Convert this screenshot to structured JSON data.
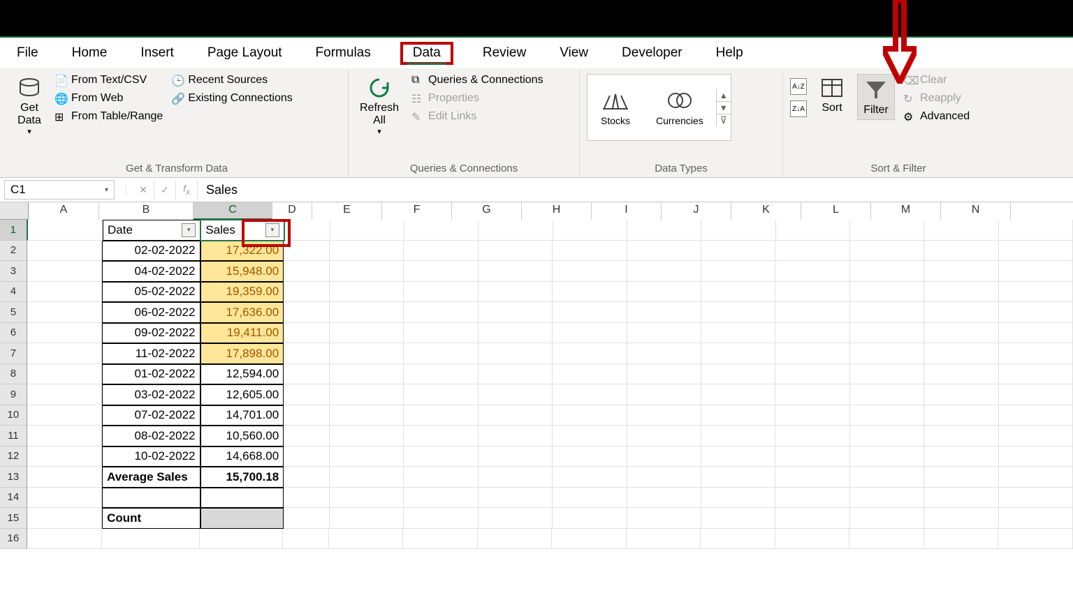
{
  "menu": [
    "File",
    "Home",
    "Insert",
    "Page Layout",
    "Formulas",
    "Data",
    "Review",
    "View",
    "Developer",
    "Help"
  ],
  "active_menu": "Data",
  "ribbon": {
    "get_transform": {
      "big": "Get\nData",
      "items": [
        "From Text/CSV",
        "From Web",
        "From Table/Range",
        "Recent Sources",
        "Existing Connections"
      ],
      "label": "Get & Transform Data"
    },
    "queries": {
      "big": "Refresh\nAll",
      "items": [
        "Queries & Connections",
        "Properties",
        "Edit Links"
      ],
      "label": "Queries & Connections"
    },
    "data_types": {
      "items": [
        "Stocks",
        "Currencies"
      ],
      "label": "Data Types"
    },
    "sort_filter": {
      "sort": "Sort",
      "filter": "Filter",
      "clear": "Clear",
      "reapply": "Reapply",
      "advanced": "Advanced",
      "label": "Sort & Filter"
    }
  },
  "name_box": "C1",
  "formula": "Sales",
  "columns": [
    "A",
    "B",
    "C",
    "D",
    "E",
    "F",
    "G",
    "H",
    "I",
    "J",
    "K",
    "L",
    "M",
    "N"
  ],
  "headers": {
    "b": "Date",
    "c": "Sales"
  },
  "data_rows": [
    {
      "date": "02-02-2022",
      "sales": "17,322.00",
      "hl": true
    },
    {
      "date": "04-02-2022",
      "sales": "15,948.00",
      "hl": true
    },
    {
      "date": "05-02-2022",
      "sales": "19,359.00",
      "hl": true
    },
    {
      "date": "06-02-2022",
      "sales": "17,636.00",
      "hl": true
    },
    {
      "date": "09-02-2022",
      "sales": "19,411.00",
      "hl": true
    },
    {
      "date": "11-02-2022",
      "sales": "17,898.00",
      "hl": true
    },
    {
      "date": "01-02-2022",
      "sales": "12,594.00",
      "hl": false
    },
    {
      "date": "03-02-2022",
      "sales": "12,605.00",
      "hl": false
    },
    {
      "date": "07-02-2022",
      "sales": "14,701.00",
      "hl": false
    },
    {
      "date": "08-02-2022",
      "sales": "10,560.00",
      "hl": false
    },
    {
      "date": "10-02-2022",
      "sales": "14,668.00",
      "hl": false
    }
  ],
  "summary": {
    "avg_label": "Average Sales",
    "avg_value": "15,700.18",
    "count_label": "Count",
    "count_value": ""
  }
}
